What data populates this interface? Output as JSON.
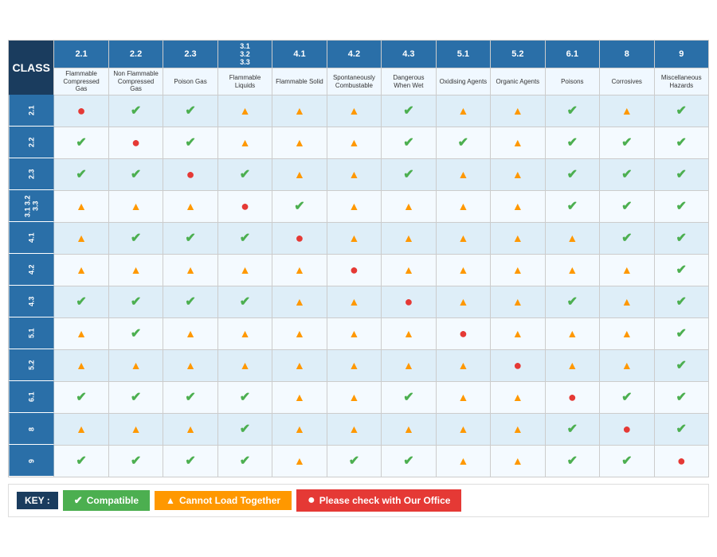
{
  "title": "CLASS",
  "columns": [
    {
      "id": "2.1",
      "label": "2.1",
      "desc": "Flammable Compressed Gas"
    },
    {
      "id": "2.2",
      "label": "2.2",
      "desc": "Non Flammable Compressed Gas"
    },
    {
      "id": "2.3",
      "label": "2.3",
      "desc": "Poison Gas"
    },
    {
      "id": "3.1-3.3",
      "label": "3.1\n3.2\n3.3",
      "desc": "Flammable Liquids"
    },
    {
      "id": "4.1",
      "label": "4.1",
      "desc": "Flammable Solid"
    },
    {
      "id": "4.2",
      "label": "4.2",
      "desc": "Spontaneously Combustable"
    },
    {
      "id": "4.3",
      "label": "4.3",
      "desc": "Dangerous When Wet"
    },
    {
      "id": "5.1",
      "label": "5.1",
      "desc": "Oxidising Agents"
    },
    {
      "id": "5.2",
      "label": "5.2",
      "desc": "Organic Agents"
    },
    {
      "id": "6.1",
      "label": "6.1",
      "desc": "Poisons"
    },
    {
      "id": "8",
      "label": "8",
      "desc": "Corrosives"
    },
    {
      "id": "9",
      "label": "9",
      "desc": "Miscellaneous Hazards"
    }
  ],
  "rows": [
    {
      "id": "2.1",
      "cells": [
        "X",
        "C",
        "C",
        "T",
        "T",
        "T",
        "C",
        "T",
        "T",
        "C",
        "T",
        "C"
      ]
    },
    {
      "id": "2.2",
      "cells": [
        "C",
        "X",
        "C",
        "T",
        "T",
        "T",
        "C",
        "C",
        "T",
        "C",
        "C",
        "C"
      ]
    },
    {
      "id": "2.3",
      "cells": [
        "C",
        "C",
        "X",
        "C",
        "T",
        "T",
        "C",
        "T",
        "T",
        "C",
        "C",
        "C"
      ]
    },
    {
      "id": "3.1\n3.2\n3.3",
      "cells": [
        "T",
        "T",
        "T",
        "X",
        "C",
        "T",
        "T",
        "T",
        "T",
        "C",
        "C",
        "C"
      ]
    },
    {
      "id": "4.1",
      "cells": [
        "T",
        "C",
        "C",
        "C",
        "X",
        "T",
        "T",
        "T",
        "T",
        "T",
        "C",
        "C"
      ]
    },
    {
      "id": "4.2",
      "cells": [
        "T",
        "T",
        "T",
        "T",
        "T",
        "X",
        "T",
        "T",
        "T",
        "T",
        "T",
        "C"
      ]
    },
    {
      "id": "4.3",
      "cells": [
        "C",
        "C",
        "C",
        "C",
        "T",
        "T",
        "X",
        "T",
        "T",
        "C",
        "T",
        "C"
      ]
    },
    {
      "id": "5.1",
      "cells": [
        "T",
        "C",
        "T",
        "T",
        "T",
        "T",
        "T",
        "X",
        "T",
        "T",
        "T",
        "C"
      ]
    },
    {
      "id": "5.2",
      "cells": [
        "T",
        "T",
        "T",
        "T",
        "T",
        "T",
        "T",
        "T",
        "X",
        "T",
        "T",
        "C"
      ]
    },
    {
      "id": "6.1",
      "cells": [
        "C",
        "C",
        "C",
        "C",
        "T",
        "T",
        "C",
        "T",
        "T",
        "X",
        "C",
        "C"
      ]
    },
    {
      "id": "8",
      "cells": [
        "T",
        "T",
        "T",
        "C",
        "T",
        "T",
        "T",
        "T",
        "T",
        "C",
        "X",
        "C"
      ]
    },
    {
      "id": "9",
      "cells": [
        "C",
        "C",
        "C",
        "C",
        "T",
        "C",
        "C",
        "T",
        "T",
        "C",
        "C",
        "X"
      ]
    }
  ],
  "legend": {
    "key": "KEY :",
    "compatible": "Compatible",
    "cannot": "Cannot Load Together",
    "check": "Please check with Our Office"
  }
}
